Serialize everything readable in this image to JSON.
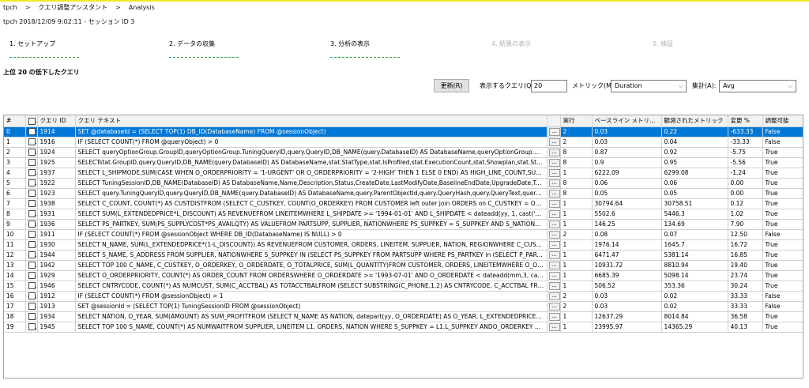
{
  "breadcrumb": [
    "tpch",
    "クエリ調整アシスタント",
    "Analysis"
  ],
  "breadcrumb_sep": ">",
  "session_info": "tpch 2018/12/09 9:02:11 - セッション ID 3",
  "steps": [
    {
      "label": "1. セットアップ",
      "state": "done"
    },
    {
      "label": "2. データの収集",
      "state": "done"
    },
    {
      "label": "3. 分析の表示",
      "state": "current"
    },
    {
      "label": "4. 結果の表示",
      "state": "inactive"
    },
    {
      "label": "5. 検証",
      "state": "inactive"
    }
  ],
  "section_title": "上位 20 の低下したクエリ",
  "controls": {
    "refresh_label": "更新(R)",
    "count_label": "表示するクエリ(Q):",
    "count_value": "20",
    "metric_label": "メトリック(M):",
    "metric_value": "Duration",
    "agg_label": "集計(A):",
    "agg_value": "Avg"
  },
  "colors": {
    "selection": "#0078d7",
    "step_done": "#2e9e3a",
    "top_accent": "#f5e71f"
  },
  "icons": {
    "dropdown": "chevron-down-icon",
    "checkbox": "checkbox-icon",
    "ellipsis": "ellipsis-button-icon"
  },
  "table": {
    "headers": {
      "index": "#",
      "query_id": "クエリ ID",
      "query_text": "クエリ テキスト",
      "exec": "実行",
      "baseline": "ベースライン メトリック",
      "observed": "観測されたメトリック",
      "change": "変更 %",
      "adjustable": "調整可能"
    },
    "ellipsis": "...",
    "rows": [
      {
        "idx": "0",
        "qid": "1914",
        "text": "SET @databaseId = (SELECT TOP(1) DB_ID(DatabaseName) FROM @sessionObject)",
        "exec": "2",
        "base": "0.03",
        "obs": "0.22",
        "chg": "-633.33",
        "adj": "False"
      },
      {
        "idx": "1",
        "qid": "1916",
        "text": "IF (SELECT COUNT(*) FROM @queryObject) > 0",
        "exec": "2",
        "base": "0.03",
        "obs": "0.04",
        "chg": "-33.33",
        "adj": "False"
      },
      {
        "idx": "2",
        "qid": "1924",
        "text": "SELECT queryOptionGroup.GroupID,queryOptionGroup.TuningQueryID,query.QueryID,DB_NAME(query.DatabaseID) AS DatabaseName,queryOptionGroup.QueryOp...",
        "exec": "8",
        "base": "0.87",
        "obs": "0.92",
        "chg": "-5.75",
        "adj": "True"
      },
      {
        "idx": "3",
        "qid": "1925",
        "text": "SELECTstat.GroupID,query.QueryID,DB_NAME(query.DatabaseID) AS DatabaseName,stat.StatType,stat.IsProfiled,stat.ExecutionCount,stat.Showplan,stat.StatsFROM m...",
        "exec": "8",
        "base": "0.9",
        "obs": "0.95",
        "chg": "-5.56",
        "adj": "True"
      },
      {
        "idx": "4",
        "qid": "1937",
        "text": "SELECT L_SHIPMODE,SUM(CASE WHEN O_ORDERPRIORITY = '1-URGENT' OR O_ORDERPRIORITY = '2-HIGH' THEN 1 ELSE 0 END) AS HIGH_LINE_COUNT,SUM(CASE ...",
        "exec": "1",
        "base": "6222.09",
        "obs": "6299.08",
        "chg": "-1.24",
        "adj": "True"
      },
      {
        "idx": "5",
        "qid": "1922",
        "text": "SELECT TuningSessionID,DB_NAME(DatabaseID) AS DatabaseName,Name,Description,Status,CreateDate,LastModifyDate,BaselineEndDate,UpgradeDate,TargetCompa...",
        "exec": "8",
        "base": "0.06",
        "obs": "0.06",
        "chg": "0.00",
        "adj": "True"
      },
      {
        "idx": "6",
        "qid": "1923",
        "text": "SELECT query.TuningQueryID,query.QueryID,DB_NAME(query.DatabaseID) AS DatabaseName,query.ParentObjectId,query.QueryHash,query.QueryText,query.QueryTy...",
        "exec": "8",
        "base": "0.05",
        "obs": "0.05",
        "chg": "0.00",
        "adj": "True"
      },
      {
        "idx": "7",
        "qid": "1938",
        "text": "SELECT C_COUNT, COUNT(*) AS CUSTDISTFROM (SELECT C_CUSTKEY, COUNT(O_ORDERKEY) FROM CUSTOMER left outer join ORDERS on C_CUSTKEY = O_CUSTKEY ...",
        "exec": "1",
        "base": "30794.64",
        "obs": "30758.51",
        "chg": "0.12",
        "adj": "True"
      },
      {
        "idx": "8",
        "qid": "1931",
        "text": "SELECT SUM(L_EXTENDEDPRICE*L_DISCOUNT) AS REVENUEFROM LINEITEMWHERE L_SHIPDATE >= '1994-01-01' AND L_SHIPDATE < dateadd(yy, 1, cast('1994-01-01...",
        "exec": "1",
        "base": "5502.6",
        "obs": "5446.3",
        "chg": "1.02",
        "adj": "True"
      },
      {
        "idx": "9",
        "qid": "1936",
        "text": "SELECT PS_PARTKEY, SUM(PS_SUPPLYCOST*PS_AVAILQTY) AS VALUEFROM PARTSUPP, SUPPLIER, NATIONWHERE PS_SUPPKEY = S_SUPPKEY AND S_NATIONKEY = ...",
        "exec": "1",
        "base": "146.25",
        "obs": "134.69",
        "chg": "7.90",
        "adj": "True"
      },
      {
        "idx": "10",
        "qid": "1911",
        "text": "IF (SELECT COUNT(*) FROM @sessionObject WHERE DB_ID(DatabaseName) IS NULL) > 0",
        "exec": "2",
        "base": "0.08",
        "obs": "0.07",
        "chg": "12.50",
        "adj": "False"
      },
      {
        "idx": "11",
        "qid": "1930",
        "text": "SELECT N_NAME, SUM(L_EXTENDEDPRICE*(1-L_DISCOUNT)) AS REVENUEFROM CUSTOMER, ORDERS, LINEITEM, SUPPLIER, NATION, REGIONWHERE C_CUSTKEY = ...",
        "exec": "1",
        "base": "1976.14",
        "obs": "1645.7",
        "chg": "16.72",
        "adj": "True"
      },
      {
        "idx": "12",
        "qid": "1944",
        "text": "SELECT S_NAME, S_ADDRESS FROM SUPPLIER, NATIONWHERE S_SUPPKEY IN (SELECT PS_SUPPKEY FROM PARTSUPP WHERE PS_PARTKEY in (SELECT P_PARTKEY FR...",
        "exec": "1",
        "base": "6471.47",
        "obs": "5381.14",
        "chg": "16.85",
        "adj": "True"
      },
      {
        "idx": "13",
        "qid": "1942",
        "text": "SELECT TOP 100 C_NAME, C_CUSTKEY, O_ORDERKEY, O_ORDERDATE, O_TOTALPRICE, SUM(L_QUANTITY)FROM CUSTOMER, ORDERS, LINEITEMWHERE O_ORDERK...",
        "exec": "1",
        "base": "10931.72",
        "obs": "8810.94",
        "chg": "19.40",
        "adj": "True"
      },
      {
        "idx": "14",
        "qid": "1929",
        "text": "SELECT O_ORDERPRIORITY, COUNT(*) AS ORDER_COUNT FROM ORDERSWHERE O_ORDERDATE >= '1993-07-01' AND O_ORDERDATE < dateadd(mm,3, cast('1993-07...",
        "exec": "1",
        "base": "6685.39",
        "obs": "5098.14",
        "chg": "23.74",
        "adj": "True"
      },
      {
        "idx": "15",
        "qid": "1946",
        "text": "SELECT CNTRYCODE, COUNT(*) AS NUMCUST, SUM(C_ACCTBAL) AS TOTACCTBALFROM (SELECT SUBSTRING(C_PHONE,1,2) AS CNTRYCODE, C_ACCTBAL FROM CUSTO...",
        "exec": "1",
        "base": "506.52",
        "obs": "353.36",
        "chg": "30.24",
        "adj": "True"
      },
      {
        "idx": "16",
        "qid": "1912",
        "text": "IF (SELECT COUNT(*) FROM @sessionObject) > 1",
        "exec": "2",
        "base": "0.03",
        "obs": "0.02",
        "chg": "33.33",
        "adj": "False"
      },
      {
        "idx": "17",
        "qid": "1913",
        "text": "SET @sessionId = (SELECT TOP(1) TuningSessionID FROM @sessionObject)",
        "exec": "2",
        "base": "0.03",
        "obs": "0.02",
        "chg": "33.33",
        "adj": "False"
      },
      {
        "idx": "18",
        "qid": "1934",
        "text": "SELECT NATION, O_YEAR, SUM(AMOUNT) AS SUM_PROFITFROM (SELECT N_NAME AS NATION, datepart(yy, O_ORDERDATE) AS O_YEAR, L_EXTENDEDPRICE*(1-L_D...",
        "exec": "1",
        "base": "12637.29",
        "obs": "8014.84",
        "chg": "36.58",
        "adj": "True"
      },
      {
        "idx": "19",
        "qid": "1945",
        "text": "SELECT TOP 100 S_NAME, COUNT(*) AS NUMWAITFROM SUPPLIER, LINEITEM L1, ORDERS, NATION WHERE S_SUPPKEY = L1.L_SUPPKEY ANDO_ORDERKEY = L1.L_O...",
        "exec": "1",
        "base": "23995.97",
        "obs": "14365.29",
        "chg": "40.13",
        "adj": "True"
      }
    ]
  }
}
